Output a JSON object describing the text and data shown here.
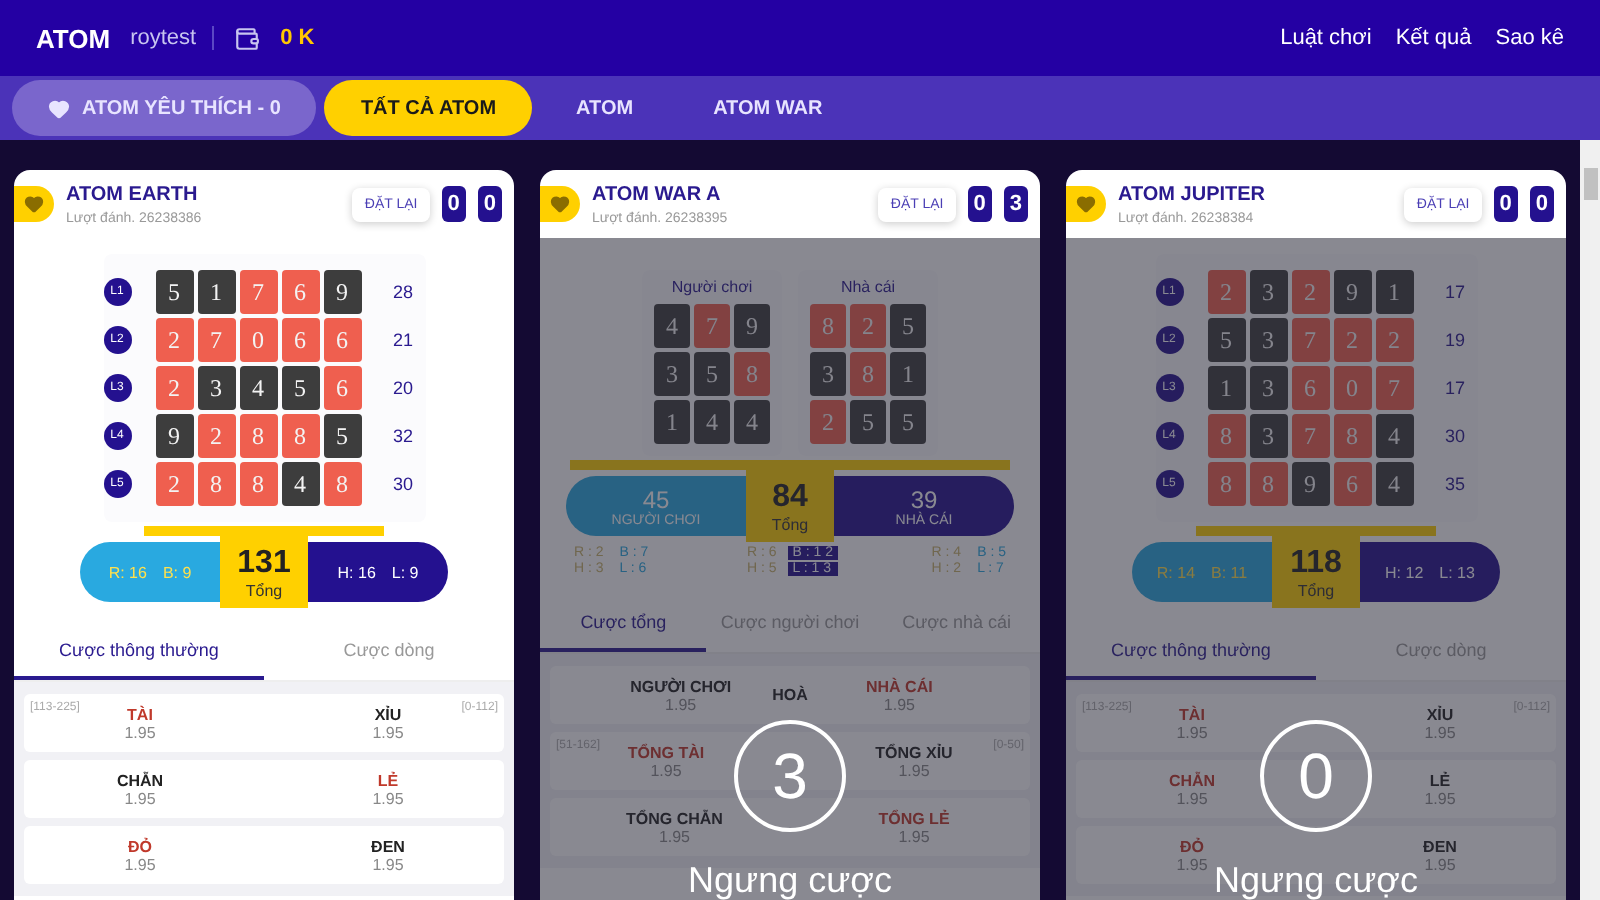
{
  "header": {
    "logo": "ATOM",
    "username": "roytest",
    "balance": "0 K",
    "links": [
      "Luật chơi",
      "Kết quả",
      "Sao kê"
    ]
  },
  "tabs": [
    {
      "label": "ATOM YÊU THÍCH - 0",
      "kind": "favorite",
      "selected": false
    },
    {
      "label": "TẤT CẢ ATOM",
      "kind": "plain",
      "selected": true
    },
    {
      "label": "ATOM",
      "kind": "plain",
      "selected": false
    },
    {
      "label": "ATOM WAR",
      "kind": "plain",
      "selected": false
    }
  ],
  "games": [
    {
      "kind": "grid",
      "title": "ATOM EARTH",
      "round": "Lượt đánh. 26238386",
      "reset": "ĐẶT LẠI",
      "score": [
        "0",
        "0"
      ],
      "locked": false,
      "rows": [
        {
          "label": "L1",
          "sum": "28",
          "cells": [
            {
              "v": "5",
              "kind": "dark"
            },
            {
              "v": "1",
              "kind": "dark"
            },
            {
              "v": "7",
              "kind": "red"
            },
            {
              "v": "6",
              "kind": "red"
            },
            {
              "v": "9",
              "kind": "dark"
            }
          ]
        },
        {
          "label": "L2",
          "sum": "21",
          "cells": [
            {
              "v": "2",
              "kind": "red"
            },
            {
              "v": "7",
              "kind": "red"
            },
            {
              "v": "0",
              "kind": "red"
            },
            {
              "v": "6",
              "kind": "red"
            },
            {
              "v": "6",
              "kind": "red"
            }
          ]
        },
        {
          "label": "L3",
          "sum": "20",
          "cells": [
            {
              "v": "2",
              "kind": "red"
            },
            {
              "v": "3",
              "kind": "dark"
            },
            {
              "v": "4",
              "kind": "dark"
            },
            {
              "v": "5",
              "kind": "dark"
            },
            {
              "v": "6",
              "kind": "red"
            }
          ]
        },
        {
          "label": "L4",
          "sum": "32",
          "cells": [
            {
              "v": "9",
              "kind": "dark"
            },
            {
              "v": "2",
              "kind": "red"
            },
            {
              "v": "8",
              "kind": "red"
            },
            {
              "v": "8",
              "kind": "red"
            },
            {
              "v": "5",
              "kind": "dark"
            }
          ]
        },
        {
          "label": "L5",
          "sum": "30",
          "cells": [
            {
              "v": "2",
              "kind": "red"
            },
            {
              "v": "8",
              "kind": "red"
            },
            {
              "v": "8",
              "kind": "red"
            },
            {
              "v": "4",
              "kind": "dark"
            },
            {
              "v": "8",
              "kind": "red"
            }
          ]
        }
      ],
      "total": "131",
      "total_label": "Tổng",
      "left_stats": [
        "R: 16",
        "B: 9"
      ],
      "right_stats": [
        "H: 16",
        "L: 9"
      ],
      "bet_tabs": [
        {
          "label": "Cược thông thường",
          "selected": true
        },
        {
          "label": "Cược dòng",
          "selected": false
        }
      ],
      "bets": [
        {
          "range_left": "[113-225]",
          "range_right": "[0-112]",
          "items": [
            {
              "name": "TÀI",
              "odds": "1.95",
              "kind": "accent"
            },
            {
              "name": "XỈU",
              "odds": "1.95",
              "kind": "plain"
            }
          ]
        },
        {
          "items": [
            {
              "name": "CHẴN",
              "odds": "1.95",
              "kind": "plain"
            },
            {
              "name": "LẺ",
              "odds": "1.95",
              "kind": "accent"
            }
          ]
        },
        {
          "items": [
            {
              "name": "ĐỎ",
              "odds": "1.95",
              "kind": "accent"
            },
            {
              "name": "ĐEN",
              "odds": "1.95",
              "kind": "plain"
            }
          ]
        }
      ]
    },
    {
      "kind": "war",
      "title": "ATOM WAR A",
      "round": "Lượt đánh. 26238395",
      "reset": "ĐẶT LẠI",
      "score": [
        "0",
        "3"
      ],
      "locked": true,
      "countdown": "3",
      "status": "Ngưng cược",
      "sides": [
        {
          "title": "Người chơi",
          "cells": [
            {
              "v": "4",
              "kind": "dark"
            },
            {
              "v": "7",
              "kind": "red"
            },
            {
              "v": "9",
              "kind": "dark"
            },
            {
              "v": "3",
              "kind": "dark"
            },
            {
              "v": "5",
              "kind": "dark"
            },
            {
              "v": "8",
              "kind": "red"
            },
            {
              "v": "1",
              "kind": "dark"
            },
            {
              "v": "4",
              "kind": "dark"
            },
            {
              "v": "4",
              "kind": "dark"
            }
          ]
        },
        {
          "title": "Nhà cái",
          "cells": [
            {
              "v": "8",
              "kind": "red"
            },
            {
              "v": "2",
              "kind": "red"
            },
            {
              "v": "5",
              "kind": "dark"
            },
            {
              "v": "3",
              "kind": "dark"
            },
            {
              "v": "8",
              "kind": "red"
            },
            {
              "v": "1",
              "kind": "dark"
            },
            {
              "v": "2",
              "kind": "red"
            },
            {
              "v": "5",
              "kind": "dark"
            },
            {
              "v": "5",
              "kind": "dark"
            }
          ]
        }
      ],
      "player_total": "45",
      "player_label": "NGƯỜI CHƠI",
      "total": "84",
      "total_label": "Tổng",
      "banker_total": "39",
      "banker_label": "NHÀ CÁI",
      "stats": [
        [
          {
            "text": "R : 2",
            "highlight": false
          },
          {
            "text": "B : 7",
            "highlight": false
          },
          {
            "text": "H : 3",
            "highlight": false
          },
          {
            "text": "L : 6",
            "highlight": false
          }
        ],
        [
          {
            "text": "R : 6",
            "highlight": false
          },
          {
            "text": "B : 1 2",
            "highlight": true
          },
          {
            "text": "H : 5",
            "highlight": false
          },
          {
            "text": "L : 1 3",
            "highlight": true
          }
        ],
        [
          {
            "text": "R : 4",
            "highlight": false
          },
          {
            "text": "B : 5",
            "highlight": false
          },
          {
            "text": "H : 2",
            "highlight": false
          },
          {
            "text": "L : 7",
            "highlight": false
          }
        ]
      ],
      "bet_tabs": [
        {
          "label": "Cược tổng",
          "selected": true
        },
        {
          "label": "Cược người chơi",
          "selected": false
        },
        {
          "label": "Cược nhà cái",
          "selected": false
        }
      ],
      "bets": [
        {
          "items": [
            {
              "name": "NGƯỜI CHƠI",
              "odds": "1.95",
              "kind": "plain"
            },
            {
              "name": "HOÀ",
              "kind": "plain"
            },
            {
              "name": "NHÀ CÁI",
              "odds": "1.95",
              "kind": "accent"
            }
          ]
        },
        {
          "range_left": "[51-162]",
          "range_right": "[0-50]",
          "items": [
            {
              "name": "TỔNG TÀI",
              "odds": "1.95",
              "kind": "accent"
            },
            {
              "name": "TỔNG XỈU",
              "odds": "1.95",
              "kind": "plain"
            }
          ]
        },
        {
          "items": [
            {
              "name": "TỔNG CHẴN",
              "odds": "1.95",
              "kind": "plain"
            },
            {
              "name": "TỔNG LẺ",
              "odds": "1.95",
              "kind": "accent"
            }
          ]
        }
      ]
    },
    {
      "kind": "grid",
      "title": "ATOM JUPITER",
      "round": "Lượt đánh. 26238384",
      "reset": "ĐẶT LẠI",
      "score": [
        "0",
        "0"
      ],
      "locked": true,
      "countdown": "0",
      "status": "Ngưng cược",
      "rows": [
        {
          "label": "L1",
          "sum": "17",
          "cells": [
            {
              "v": "2",
              "kind": "red"
            },
            {
              "v": "3",
              "kind": "dark"
            },
            {
              "v": "2",
              "kind": "red"
            },
            {
              "v": "9",
              "kind": "dark"
            },
            {
              "v": "1",
              "kind": "dark"
            }
          ]
        },
        {
          "label": "L2",
          "sum": "19",
          "cells": [
            {
              "v": "5",
              "kind": "dark"
            },
            {
              "v": "3",
              "kind": "dark"
            },
            {
              "v": "7",
              "kind": "red"
            },
            {
              "v": "2",
              "kind": "red"
            },
            {
              "v": "2",
              "kind": "red"
            }
          ]
        },
        {
          "label": "L3",
          "sum": "17",
          "cells": [
            {
              "v": "1",
              "kind": "dark"
            },
            {
              "v": "3",
              "kind": "dark"
            },
            {
              "v": "6",
              "kind": "red"
            },
            {
              "v": "0",
              "kind": "red"
            },
            {
              "v": "7",
              "kind": "red"
            }
          ]
        },
        {
          "label": "L4",
          "sum": "30",
          "cells": [
            {
              "v": "8",
              "kind": "red"
            },
            {
              "v": "3",
              "kind": "dark"
            },
            {
              "v": "7",
              "kind": "red"
            },
            {
              "v": "8",
              "kind": "red"
            },
            {
              "v": "4",
              "kind": "dark"
            }
          ]
        },
        {
          "label": "L5",
          "sum": "35",
          "cells": [
            {
              "v": "8",
              "kind": "red"
            },
            {
              "v": "8",
              "kind": "red"
            },
            {
              "v": "9",
              "kind": "dark"
            },
            {
              "v": "6",
              "kind": "red"
            },
            {
              "v": "4",
              "kind": "dark"
            }
          ]
        }
      ],
      "total": "118",
      "total_label": "Tổng",
      "left_stats": [
        "R: 14",
        "B: 11"
      ],
      "right_stats": [
        "H: 12",
        "L: 13"
      ],
      "bet_tabs": [
        {
          "label": "Cược thông thường",
          "selected": true
        },
        {
          "label": "Cược dòng",
          "selected": false
        }
      ],
      "bets": [
        {
          "range_left": "[113-225]",
          "range_right": "[0-112]",
          "items": [
            {
              "name": "TÀI",
              "odds": "1.95",
              "kind": "accent"
            },
            {
              "name": "XỈU",
              "odds": "1.95",
              "kind": "plain"
            }
          ]
        },
        {
          "items": [
            {
              "name": "CHẴN",
              "odds": "1.95",
              "kind": "accent"
            },
            {
              "name": "LẺ",
              "odds": "1.95",
              "kind": "plain"
            }
          ]
        },
        {
          "items": [
            {
              "name": "ĐỎ",
              "odds": "1.95",
              "kind": "accent"
            },
            {
              "name": "ĐEN",
              "odds": "1.95",
              "kind": "plain"
            }
          ]
        }
      ]
    }
  ]
}
